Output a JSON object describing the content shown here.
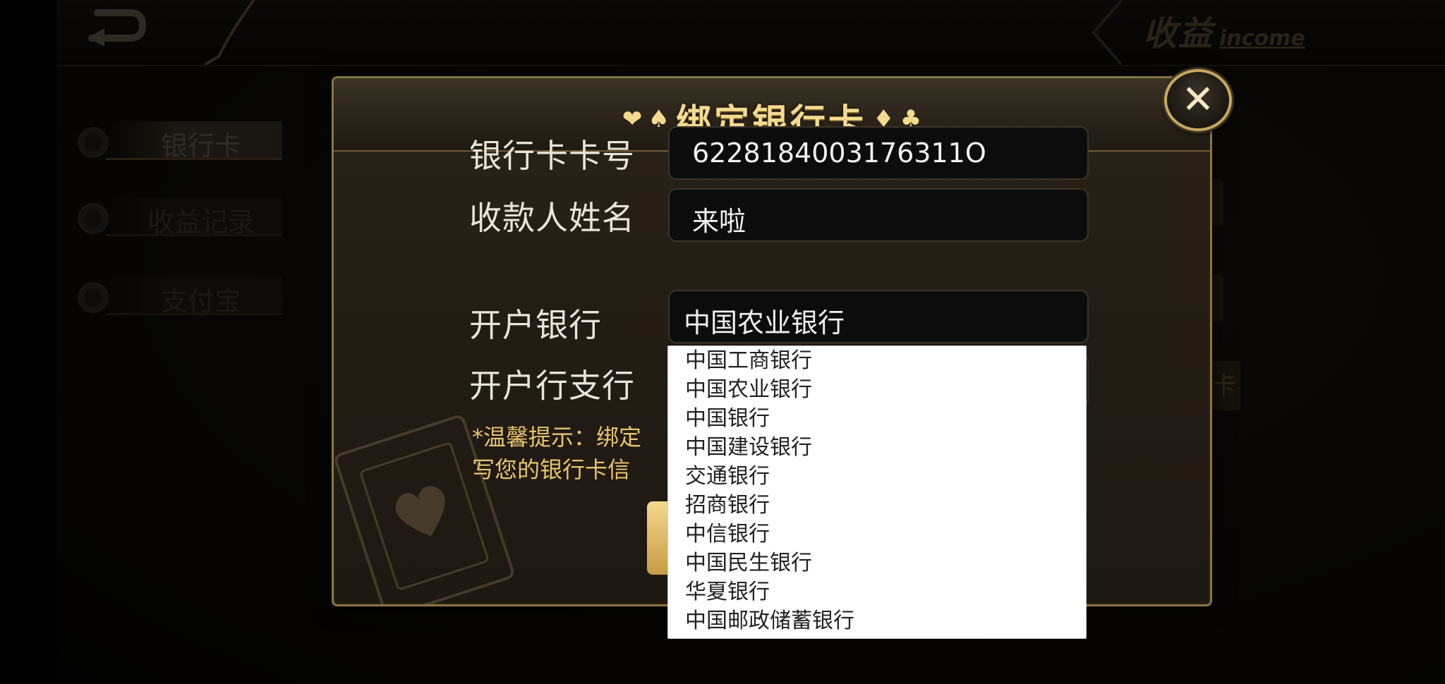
{
  "topbar": {
    "income_cn": "收益",
    "income_en": "income"
  },
  "sidebar": {
    "items": [
      {
        "label": "银行卡"
      },
      {
        "label": "收益记录"
      },
      {
        "label": "支付宝"
      }
    ]
  },
  "background": {
    "right_tab_label": "卡"
  },
  "dialog": {
    "title": "绑定银行卡",
    "suits_left": [
      "❤",
      "♠"
    ],
    "suits_right": [
      "♦",
      "♣"
    ],
    "card_number_label": "银行卡卡号",
    "card_number_value": "6228184003176311O",
    "payee_name_label": "收款人姓名",
    "payee_name_value": "来啦",
    "bank_label": "开户银行",
    "bank_value": "中国农业银行",
    "branch_label": "开户行支行",
    "tip_line1": "*温馨提示：绑定",
    "tip_line2": "写您的银行卡信"
  },
  "dropdown": {
    "options": [
      "中国工商银行",
      "中国农业银行",
      "中国银行",
      "中国建设银行",
      "交通银行",
      "招商银行",
      "中信银行",
      "中国民生银行",
      "华夏银行",
      "中国邮政储蓄银行"
    ]
  },
  "icons": {
    "close": "close-icon",
    "back": "back-arrow-icon"
  }
}
